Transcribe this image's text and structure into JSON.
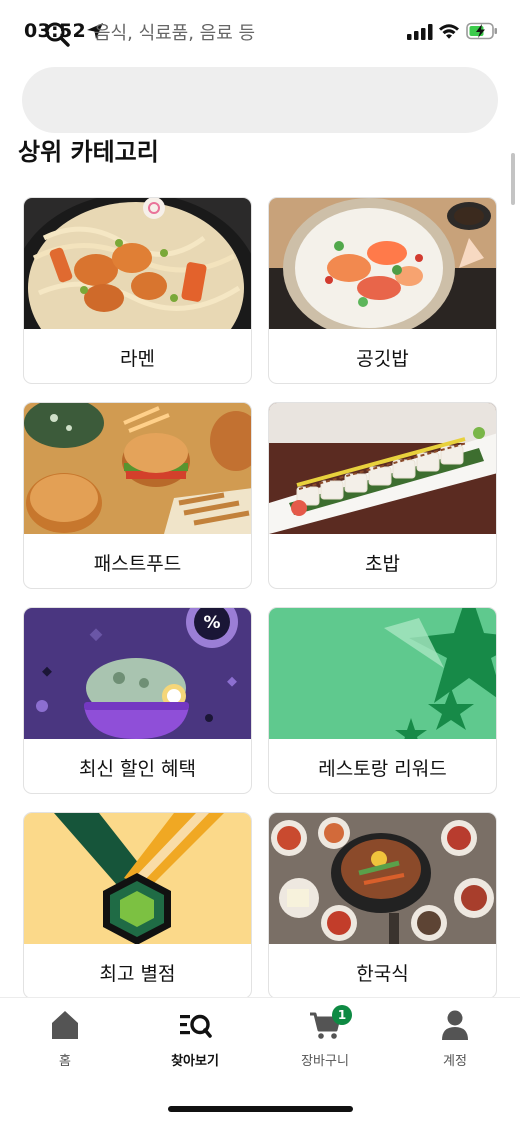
{
  "status_bar": {
    "time": "03:52",
    "icons": [
      "location-arrow-icon",
      "signal-icon",
      "wifi-icon",
      "battery-charging-icon"
    ]
  },
  "search": {
    "placeholder": "음식, 식료품, 음료 등",
    "icon": "search-icon"
  },
  "section": {
    "title": "상위 카테고리"
  },
  "categories": [
    {
      "label": "라멘",
      "image": "ramen-with-shrimp"
    },
    {
      "label": "공깃밥",
      "image": "poke-rice-bowl"
    },
    {
      "label": "패스트푸드",
      "image": "burgers-and-fries"
    },
    {
      "label": "초밥",
      "image": "sushi-roll"
    },
    {
      "label": "최신 할인 혜택",
      "image": "discount-illustration"
    },
    {
      "label": "레스토랑 리워드",
      "image": "rewards-stars"
    },
    {
      "label": "최고 별점",
      "image": "top-rated-medal"
    },
    {
      "label": "한국식",
      "image": "korean-bibimbap-spread"
    }
  ],
  "bottom_nav": {
    "items": [
      {
        "label": "홈",
        "icon": "home-icon",
        "active": false
      },
      {
        "label": "찾아보기",
        "icon": "browse-icon",
        "active": true
      },
      {
        "label": "장바구니",
        "icon": "cart-icon",
        "active": false,
        "badge": "1"
      },
      {
        "label": "계정",
        "icon": "account-icon",
        "active": false
      }
    ]
  },
  "colors": {
    "accent_green": "#0e8a43",
    "search_bg": "#eeeeee",
    "discount_purple": "#4a3680",
    "rewards_green": "#5fc98e",
    "medal_yellow": "#fbd98a"
  }
}
